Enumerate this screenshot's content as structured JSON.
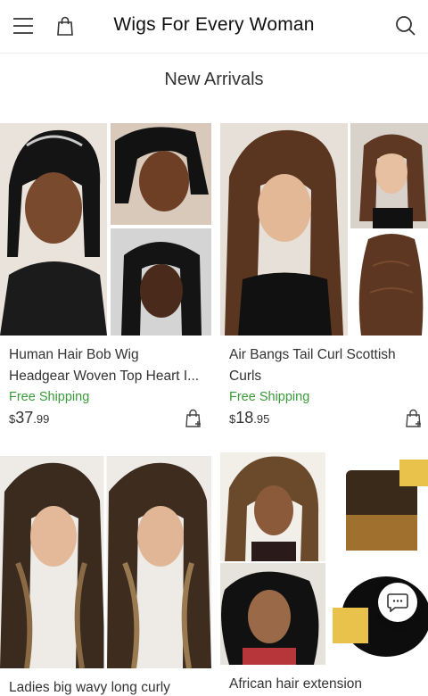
{
  "header": {
    "title": "Wigs For Every Woman",
    "menu_icon": "hamburger-menu-icon",
    "bag_icon": "shopping-bag-icon",
    "search_icon": "search-icon"
  },
  "section": {
    "title": "New Arrivals"
  },
  "products": [
    {
      "name": "Human Hair Bob Wig Headgear Woven Top Heart I...",
      "shipping": "Free Shipping",
      "price_currency": "$",
      "price_int": "37",
      "price_dec": ".99",
      "cart_icon": "add-to-cart-icon"
    },
    {
      "name": "Air Bangs Tail Curl Scottish Curls",
      "shipping": "Free Shipping",
      "price_currency": "$",
      "price_int": "18",
      "price_dec": ".95",
      "cart_icon": "add-to-cart-icon"
    },
    {
      "name": "Ladies big wavy long curly",
      "shipping": "",
      "price_currency": "",
      "price_int": "",
      "price_dec": ""
    },
    {
      "name": "African hair extension",
      "shipping": "",
      "price_currency": "",
      "price_int": "",
      "price_dec": ""
    }
  ],
  "chat_icon": "chat-bubble-icon",
  "colors": {
    "shipping": "#3a9a3a",
    "text": "#333333"
  }
}
